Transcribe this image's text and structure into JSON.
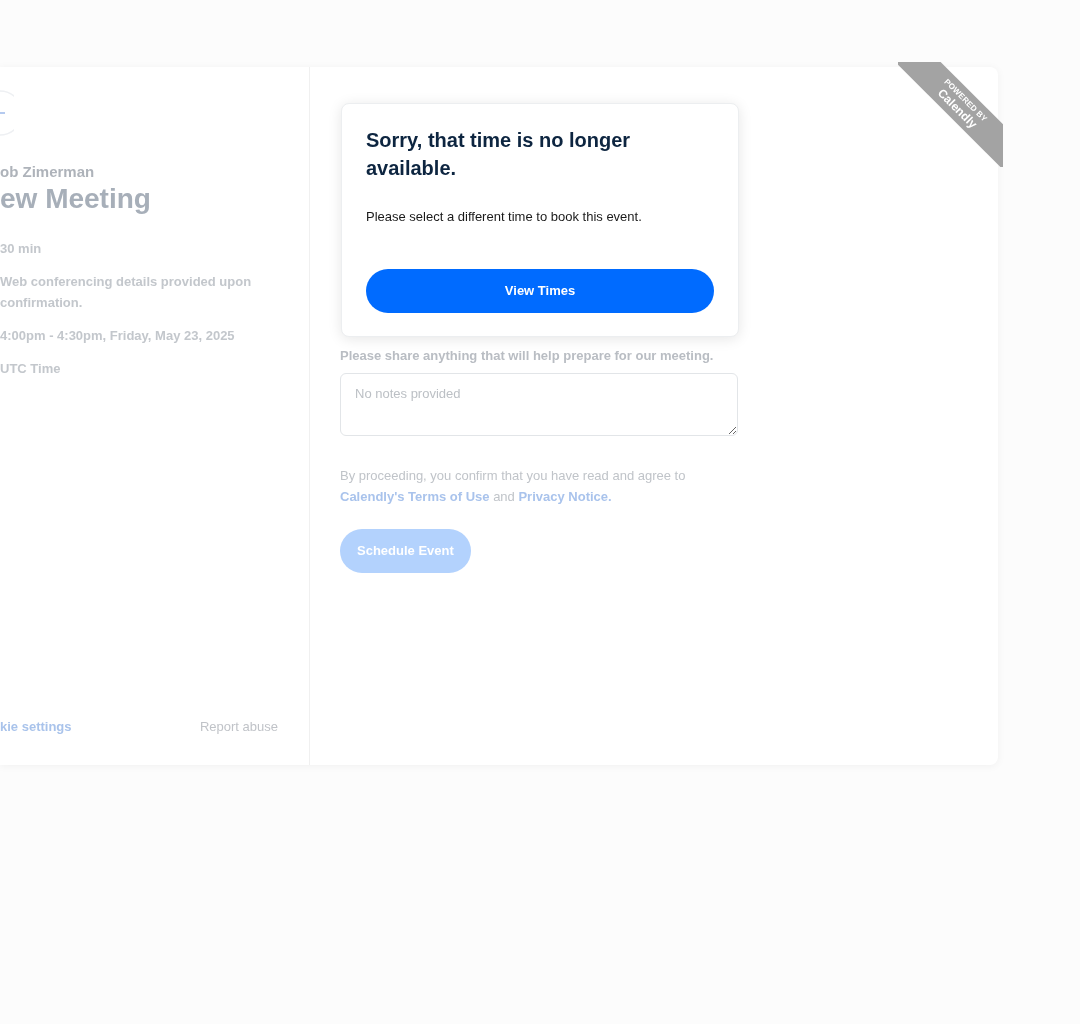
{
  "event": {
    "organizer": "ob Zimerman",
    "title": "ew Meeting",
    "details": [
      "30 min",
      "Web conferencing details provided upon confirmation.",
      "4:00pm - 4:30pm, Friday, May 23, 2025",
      "UTC Time"
    ]
  },
  "footer_links": [
    {
      "label": "kie settings",
      "kind": "link"
    },
    {
      "label": "Report abuse",
      "kind": "muted"
    }
  ],
  "form": {
    "notes_label": "Please share anything that will help prepare for our meeting.",
    "notes": {
      "placeholder": "No notes provided"
    },
    "consent": {
      "text": "By proceeding, you confirm that you have read and agree to",
      "links": [
        "Calendly's Terms of Use",
        "Privacy Notice."
      ],
      "joiner": "and"
    },
    "submit": {
      "label": "Schedule Event",
      "disabled": true
    }
  },
  "modal": {
    "title": "Sorry, that time is no longer available.",
    "message": "Please select a different time to book this event.",
    "button": "View Times"
  },
  "ribbon": {
    "line_1": "POWERED BY",
    "line_2": "Calendly"
  }
}
